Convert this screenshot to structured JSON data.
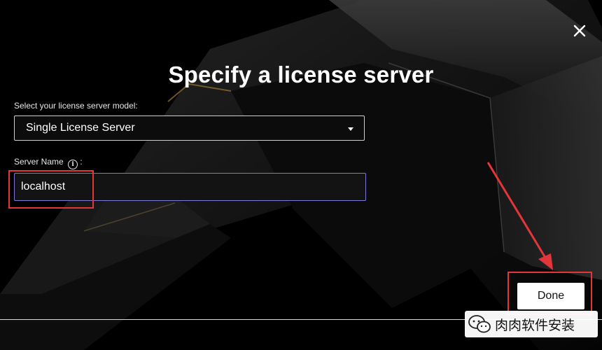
{
  "dialog": {
    "title": "Specify a license server",
    "close_icon": "close-icon"
  },
  "model": {
    "label": "Select your license server model:",
    "selected": "Single License Server",
    "caret_icon": "chevron-down-icon"
  },
  "server": {
    "label": "Server Name",
    "info_icon_glyph": "i",
    "colon": ":",
    "value": "localhost"
  },
  "actions": {
    "done_label": "Done"
  },
  "annotations": {
    "color": "#e2363a",
    "focus_color": "#7f78d8"
  },
  "watermark": {
    "text": "肉肉软件安装",
    "icon": "wechat-icon"
  }
}
